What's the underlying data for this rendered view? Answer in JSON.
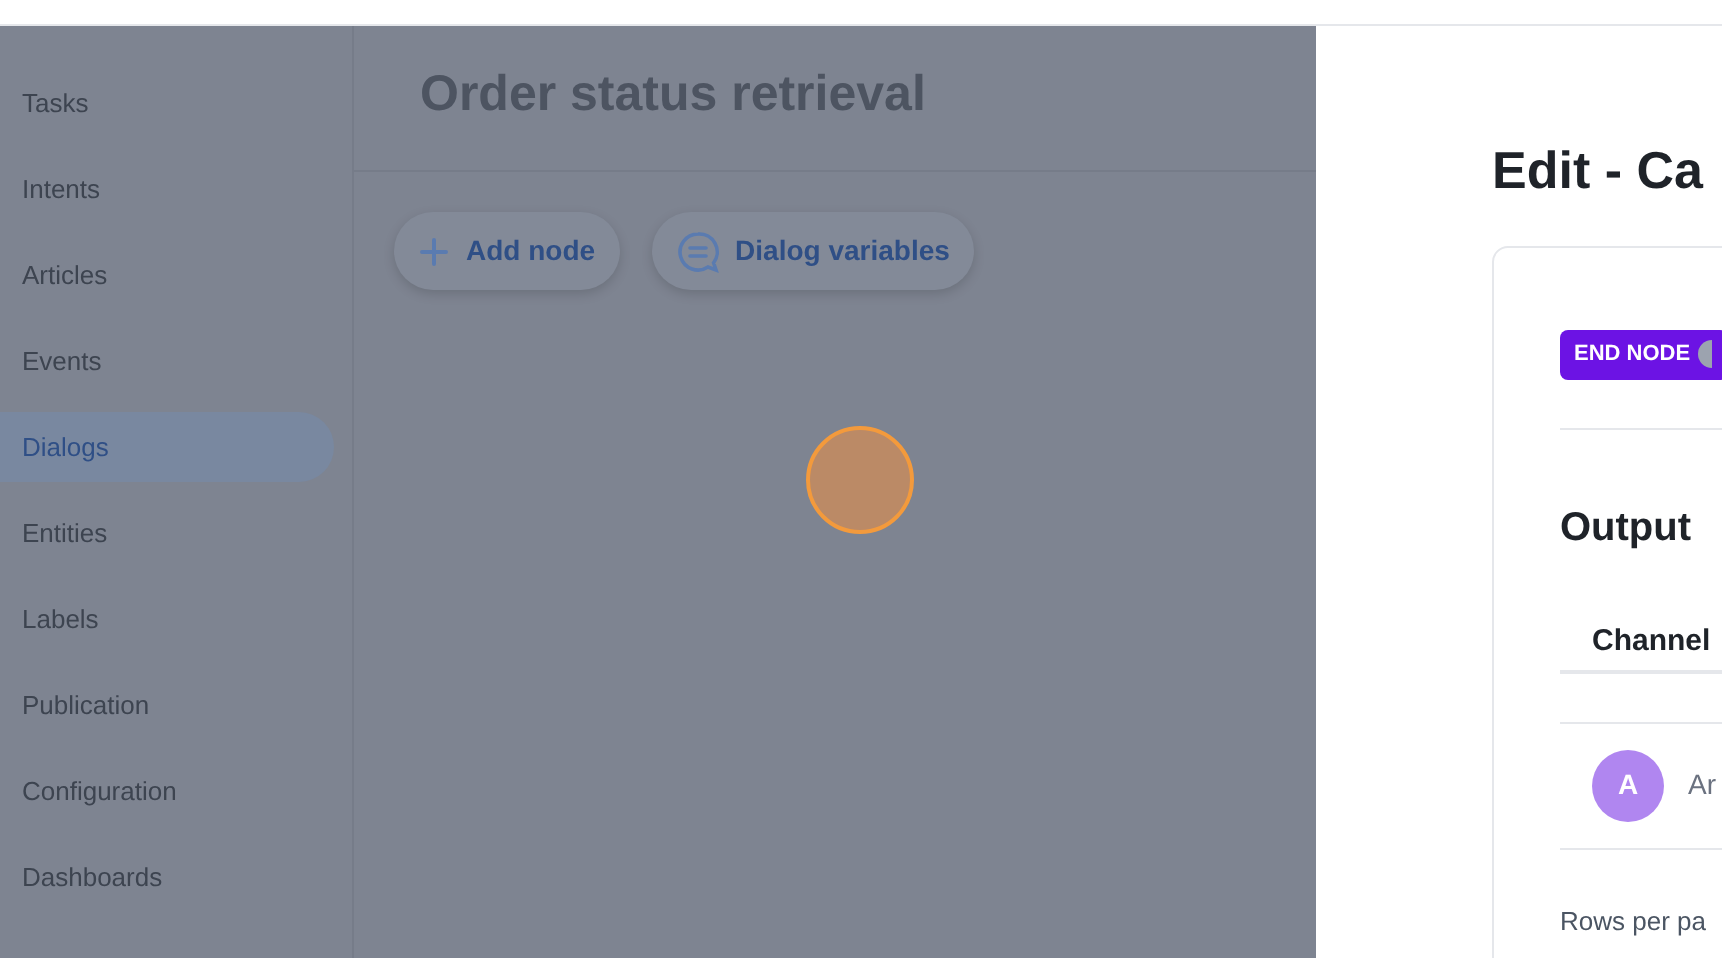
{
  "sidebar": {
    "items": [
      {
        "label": "Tasks",
        "selected": false
      },
      {
        "label": "Intents",
        "selected": false
      },
      {
        "label": "Articles",
        "selected": false
      },
      {
        "label": "Events",
        "selected": false
      },
      {
        "label": "Dialogs",
        "selected": true
      },
      {
        "label": "Entities",
        "selected": false
      },
      {
        "label": "Labels",
        "selected": false
      },
      {
        "label": "Publication",
        "selected": false
      },
      {
        "label": "Configuration",
        "selected": false
      },
      {
        "label": "Dashboards",
        "selected": false
      }
    ]
  },
  "page": {
    "title": "Order status retrieval",
    "buttons": [
      {
        "label": "Add node",
        "kind": "add"
      },
      {
        "label": "Dialog variables",
        "kind": "variables"
      }
    ]
  },
  "drawer": {
    "title": "Edit - Ca",
    "badge": "END NODE",
    "section_title": "Output",
    "table": {
      "columns": [
        "Channel"
      ],
      "rows": [
        {
          "avatar": "A",
          "column_2": "Ar"
        }
      ]
    },
    "footer": "Rows per pa"
  }
}
